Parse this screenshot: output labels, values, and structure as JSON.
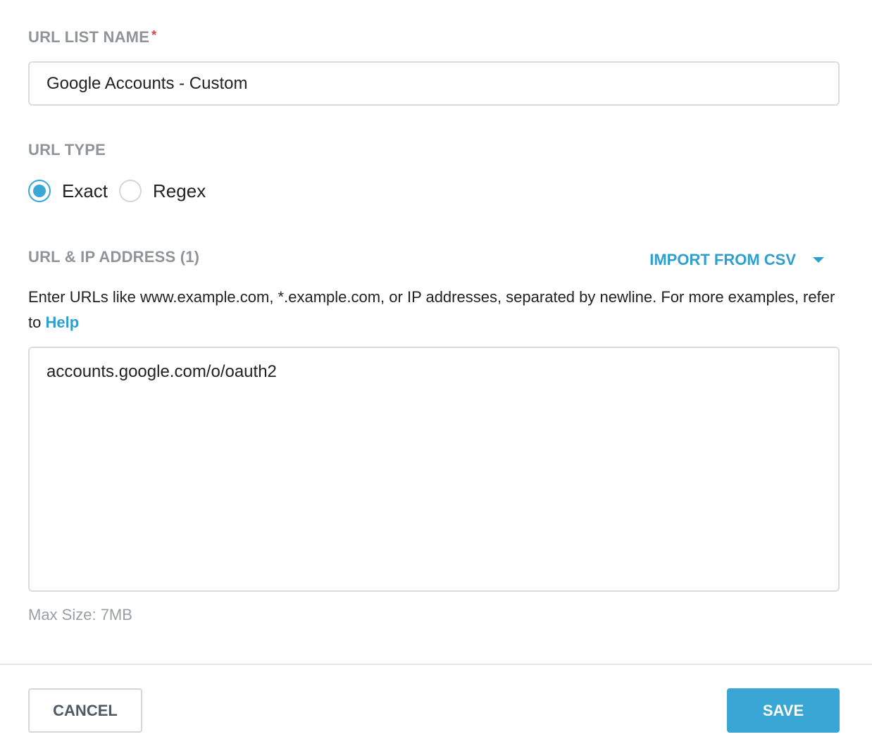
{
  "form": {
    "name_label": "URL LIST NAME",
    "required_mark": "*",
    "name_value": "Google Accounts - Custom",
    "type_label": "URL TYPE",
    "type_options": [
      {
        "label": "Exact",
        "checked": true
      },
      {
        "label": "Regex",
        "checked": false
      }
    ],
    "url_label": "URL & IP ADDRESS (1)",
    "import_label": "IMPORT FROM CSV",
    "help_text": "Enter URLs like www.example.com, *.example.com, or IP addresses, separated by newline. For more examples, refer to ",
    "help_link": "Help",
    "urls_value": "accounts.google.com/o/oauth2",
    "max_size": "Max Size: 7MB"
  },
  "footer": {
    "cancel_label": "CANCEL",
    "save_label": "SAVE"
  },
  "colors": {
    "accent": "#3aa6d6",
    "link": "#2f9fcf",
    "required": "#e0423c",
    "label": "#8f9499"
  },
  "icons": {
    "import_caret": "caret-down-icon"
  }
}
